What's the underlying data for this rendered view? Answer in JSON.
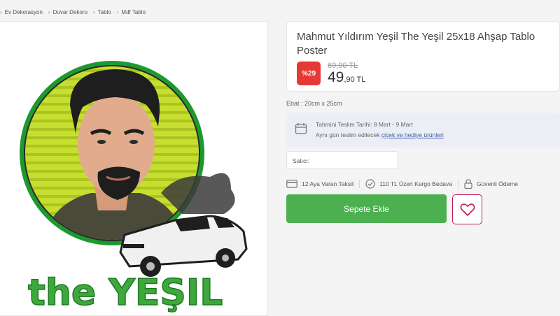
{
  "breadcrumb": [
    {
      "label": "Ev Dekorasyon"
    },
    {
      "label": "Duvar Dekoru"
    },
    {
      "label": "Tablo"
    },
    {
      "label": "Mdf Tablo"
    }
  ],
  "product": {
    "title": "Mahmut Yıldırım Yeşil The Yeşil 25x18 Ahşap Tablo Poster",
    "discount": "%29",
    "old_price": "69,90 TL",
    "price_int": "49",
    "price_dec": ",90 TL",
    "size": "Ebat : 20cm x 25cm",
    "artwork_text": "the YEŞIL"
  },
  "delivery": {
    "estimate": "Tahmini Teslim Tarihi: 8 Mart - 9 Mart",
    "note": "Aynı gün teslim edilecek",
    "link": "çiçek ve hediye ürünleri"
  },
  "seller": {
    "label": "Satıcı:"
  },
  "features": [
    {
      "icon": "card-icon",
      "label": "12 Aya Varan Taksit"
    },
    {
      "icon": "check-circle-icon",
      "label": "110 TL Üzeri Kargo Bedava"
    },
    {
      "icon": "lock-icon",
      "label": "Güvenli Ödeme"
    }
  ],
  "actions": {
    "add_to_cart": "Sepete Ekle"
  },
  "colors": {
    "green": "#4caf50",
    "discount_red": "#e53935",
    "heart": "#c2185b"
  }
}
